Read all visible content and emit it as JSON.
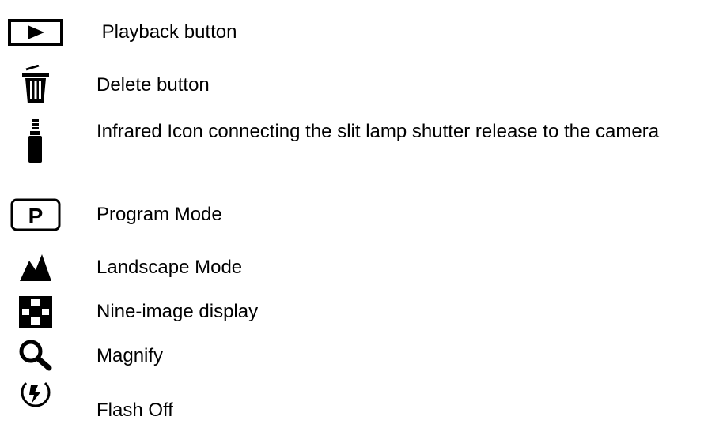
{
  "legend": {
    "items": [
      {
        "icon": "playback-icon",
        "label": " Playback button"
      },
      {
        "icon": "trash-icon",
        "label": "Delete button"
      },
      {
        "icon": "infrared-icon",
        "label": "Infrared Icon connecting the slit lamp shutter release to the camera"
      },
      {
        "icon": "program-mode-icon",
        "label": "Program Mode",
        "icon_text": "P"
      },
      {
        "icon": "landscape-mountain-icon",
        "label": "Landscape Mode"
      },
      {
        "icon": "nine-image-grid-icon",
        "label": "Nine-image display"
      },
      {
        "icon": "magnify-icon",
        "label": "Magnify"
      },
      {
        "icon": "flash-off-icon",
        "label": "Flash Off"
      }
    ]
  }
}
